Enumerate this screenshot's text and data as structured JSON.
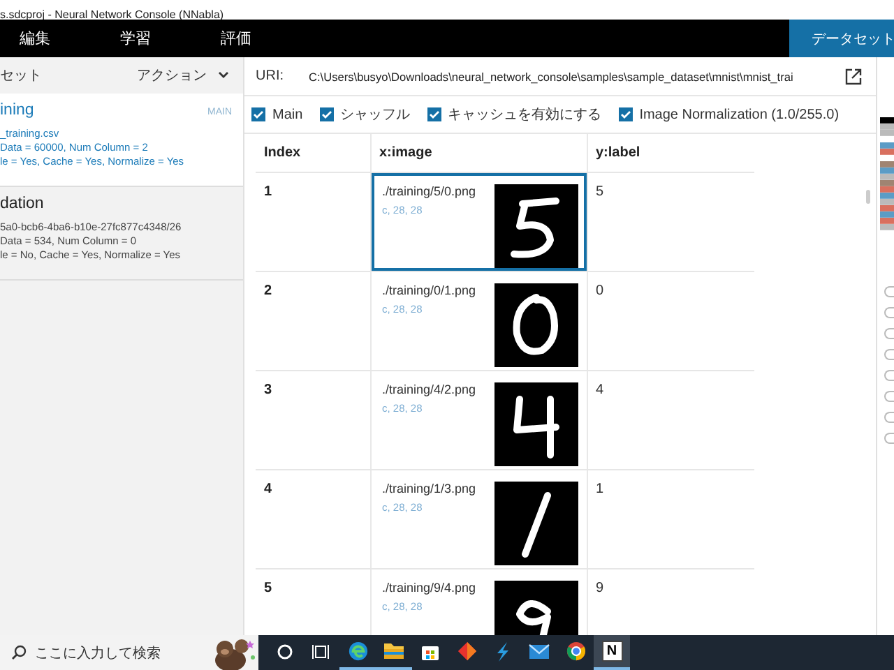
{
  "window": {
    "title": "s.sdcproj - Neural Network Console (NNabla)"
  },
  "menu": [
    {
      "label": "編集"
    },
    {
      "label": "学習"
    },
    {
      "label": "評価"
    }
  ],
  "dataset_button": {
    "label": "データセット",
    "selected": true
  },
  "dataset_panel": {
    "header": "セット",
    "action": "アクション",
    "datasets": [
      {
        "name": "ining",
        "badge": "MAIN",
        "selected": true,
        "lines": [
          "_training.csv",
          "Data = 60000, Num Column = 2",
          "le = Yes, Cache = Yes, Normalize = Yes"
        ]
      },
      {
        "name": "dation",
        "selected": false,
        "lines": [
          "5a0-bcb6-4ba6-b10e-27fc877c4348/26",
          "Data = 534, Num Column = 0",
          "le = No, Cache = Yes, Normalize = Yes"
        ]
      }
    ]
  },
  "uri": {
    "label": "URI:",
    "value": "C:\\Users\\busyo\\Downloads\\neural_network_console\\samples\\sample_dataset\\mnist\\mnist_trai"
  },
  "options": [
    {
      "label": "Main",
      "checked": true
    },
    {
      "label": "シャッフル",
      "checked": true
    },
    {
      "label": "キャッシュを有効にする",
      "checked": true
    },
    {
      "label": "Image Normalization (1.0/255.0)",
      "checked": true
    }
  ],
  "table": {
    "columns": [
      "Index",
      "x:image",
      "y:label"
    ],
    "rows": [
      {
        "index": "1",
        "path": "./training/5/0.png",
        "shape": "c, 28, 28",
        "label": "5",
        "selected": true
      },
      {
        "index": "2",
        "path": "./training/0/1.png",
        "shape": "c, 28, 28",
        "label": "0",
        "selected": false
      },
      {
        "index": "3",
        "path": "./training/4/2.png",
        "shape": "c, 28, 28",
        "label": "4",
        "selected": false
      },
      {
        "index": "4",
        "path": "./training/1/3.png",
        "shape": "c, 28, 28",
        "label": "1",
        "selected": false
      },
      {
        "index": "5",
        "path": "./training/9/4.png",
        "shape": "c, 28, 28",
        "label": "9",
        "selected": false
      }
    ]
  },
  "taskbar": {
    "search": {
      "placeholder": "ここに入力して検索"
    },
    "apps": [
      {
        "kind": "cortana",
        "running": false,
        "selected": false
      },
      {
        "kind": "taskview",
        "running": false,
        "selected": false
      },
      {
        "kind": "edge",
        "running": true,
        "selected": false
      },
      {
        "kind": "files",
        "running": true,
        "selected": false
      },
      {
        "kind": "store",
        "running": false,
        "selected": false
      },
      {
        "kind": "diamond",
        "running": false,
        "selected": false
      },
      {
        "kind": "lightning",
        "running": false,
        "selected": false
      },
      {
        "kind": "mail",
        "running": false,
        "selected": false
      },
      {
        "kind": "chrome",
        "running": false,
        "selected": false
      },
      {
        "kind": "text",
        "label": "N",
        "running": true,
        "selected": true
      }
    ]
  }
}
